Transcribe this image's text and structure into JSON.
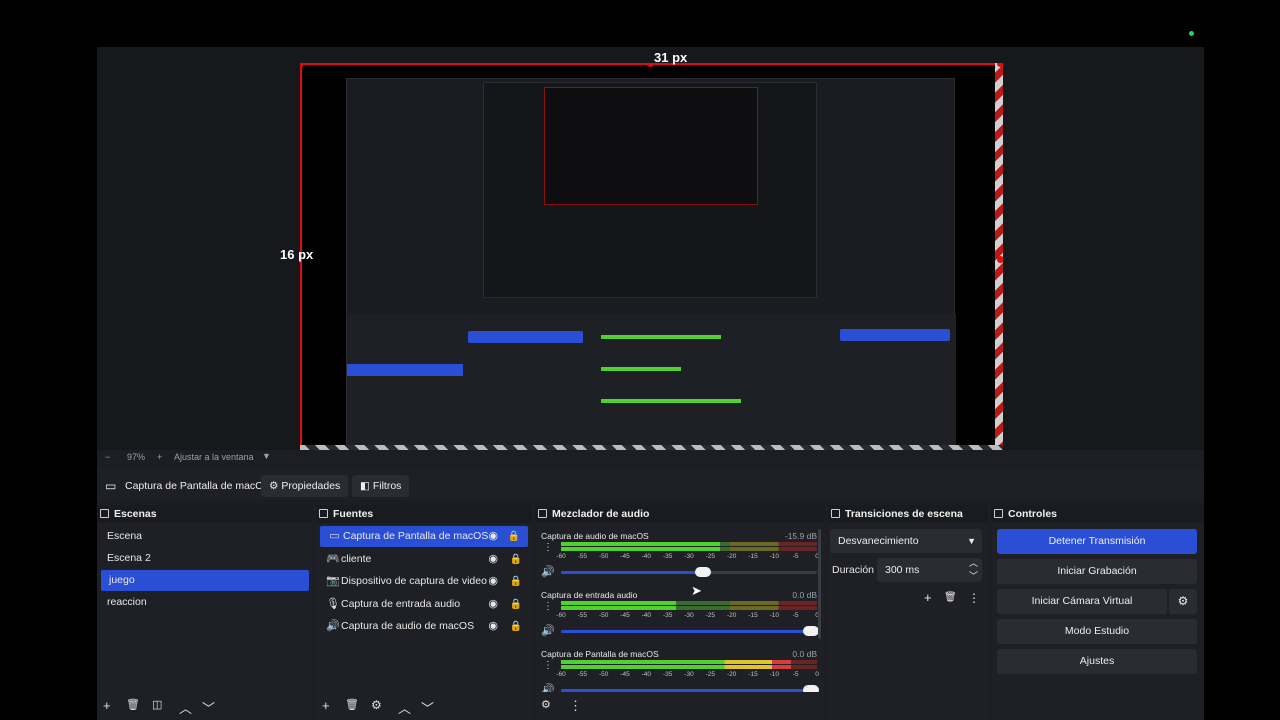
{
  "preview": {
    "width_label_top": "31 px",
    "height_label_left": "16 px"
  },
  "zoombar": {
    "minus": "−",
    "zoom": "97%",
    "plus": "+",
    "fit": "Ajustar a la ventana"
  },
  "source_toolbar": {
    "source_name": "Captura de Pantalla de macC",
    "properties": "Propiedades",
    "filters": "Filtros"
  },
  "scenes": {
    "title": "Escenas",
    "items": [
      "Escena",
      "Escena 2",
      "juego",
      "reaccion"
    ],
    "selected": "juego"
  },
  "sources": {
    "title": "Fuentes",
    "items": [
      {
        "label": "Captura de Pantalla de macOS",
        "icon": "monitor-icon"
      },
      {
        "label": "cliente",
        "icon": "gamepad-icon"
      },
      {
        "label": "Dispositivo de captura de video",
        "icon": "camera-icon"
      },
      {
        "label": "Captura de entrada audio",
        "icon": "microphone-icon"
      },
      {
        "label": "Captura de audio de macOS",
        "icon": "speaker-icon"
      }
    ]
  },
  "mixer": {
    "title": "Mezclador de audio",
    "scale": [
      "-60",
      "-55",
      "-50",
      "-45",
      "-40",
      "-35",
      "-30",
      "-25",
      "-20",
      "-15",
      "-10",
      "-5",
      "0"
    ],
    "channels": [
      {
        "name": "Captura de audio de macOS",
        "db": "-15.9 dB",
        "level": 0.62,
        "volume": 0.58
      },
      {
        "name": "Captura de entrada audio",
        "db": "0.0 dB",
        "level": 0.45,
        "volume": 1.0
      },
      {
        "name": "Captura de Pantalla de macOS",
        "db": "0.0 dB",
        "level": 0.9,
        "volume": 1.0
      }
    ]
  },
  "transitions": {
    "title": "Transiciones de escena",
    "type": "Desvanecimiento",
    "duration_label": "Duración",
    "duration_value": "300 ms"
  },
  "controls": {
    "title": "Controles",
    "stop_stream": "Detener Transmisión",
    "start_recording": "Iniciar Grabación",
    "start_virtual_cam": "Iniciar Cámara Virtual",
    "studio_mode": "Modo Estudio",
    "settings": "Ajustes"
  },
  "colors": {
    "accent": "#2b4fd4",
    "selection_red": "#e10c0c",
    "panel": "#1f2026"
  }
}
